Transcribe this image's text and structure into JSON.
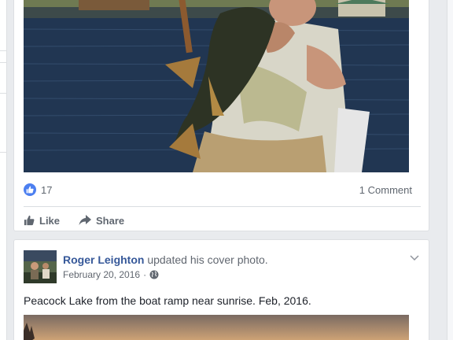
{
  "post1": {
    "like_count": "17",
    "comment_count": "1 Comment",
    "actions": {
      "like": "Like",
      "share": "Share"
    }
  },
  "post2": {
    "author": "Roger Leighton",
    "action_text": "updated his cover photo.",
    "date": "February 20, 2016",
    "separator": "·",
    "text": "Peacock Lake from the boat ramp near sunrise. Feb, 2016."
  },
  "icons": {
    "like_badge": "thumbs-up-icon",
    "audience": "globe-icon",
    "options": "chevron-down-icon"
  },
  "colors": {
    "link": "#365899",
    "like_blue": "#4c7ff0",
    "meta_gray": "#616770",
    "background": "#e9ebee"
  }
}
